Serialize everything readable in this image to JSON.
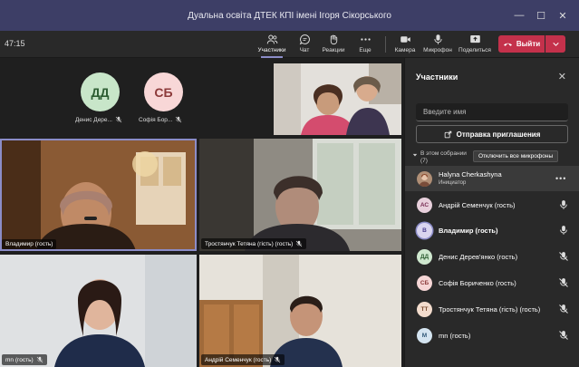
{
  "window": {
    "title": "Дуальна освіта ДТЕК КПІ імені Ігоря Сікорського"
  },
  "toolbar": {
    "timer": "47:15",
    "participants": "Участники",
    "chat": "Чат",
    "reactions": "Реакции",
    "more": "Еще",
    "camera": "Камера",
    "mic": "Микрофон",
    "share": "Поделиться",
    "leave": "Выйти"
  },
  "stage": {
    "small_avatars": [
      {
        "initials": "ДД",
        "name": "Денис Дере...",
        "bg": "#c8e6c9",
        "fg": "#2e5e33"
      },
      {
        "initials": "СБ",
        "name": "Софія Бор...",
        "bg": "#f8d7d7",
        "fg": "#8c3a3a"
      }
    ],
    "tiles": [
      {
        "name": "Владимир (гость)"
      },
      {
        "name": "Тростянчук Тетяна (гість) (гость)"
      },
      {
        "name": "mn (гость)"
      },
      {
        "name": "Андрій Семенчук (гость)"
      }
    ]
  },
  "panel": {
    "title": "Участники",
    "search_placeholder": "Введите имя",
    "invite_label": "Отправка приглашения",
    "in_meeting_line1": "В этом собрании",
    "in_meeting_line2": "(7)",
    "mute_all": "Отключить все микрофоны",
    "participants": [
      {
        "initials": "",
        "name": "Halyna Cherkashyna",
        "role": "Инициатор",
        "bg": "#b08f76",
        "fg": "#fff"
      },
      {
        "initials": "АС",
        "name": "Андрій Семенчук (гость)",
        "bg": "#e8d0dc",
        "fg": "#7a2f55"
      },
      {
        "initials": "В",
        "name": "Владимир (гость)",
        "bg": "#d9d4ef",
        "fg": "#4b3f8f"
      },
      {
        "initials": "ДД",
        "name": "Денис Дерев'янко (гость)",
        "bg": "#cfe8cf",
        "fg": "#2e5e33"
      },
      {
        "initials": "СБ",
        "name": "Софія Бориченко (гость)",
        "bg": "#f6d6d6",
        "fg": "#8c3a3a"
      },
      {
        "initials": "ТТ",
        "name": "Тростянчук Тетяна (гість) (гость)",
        "bg": "#f3dccd",
        "fg": "#7a4a2e"
      },
      {
        "initials": "M",
        "name": "mn (гость)",
        "bg": "#d4e4f0",
        "fg": "#2f5777"
      }
    ]
  }
}
